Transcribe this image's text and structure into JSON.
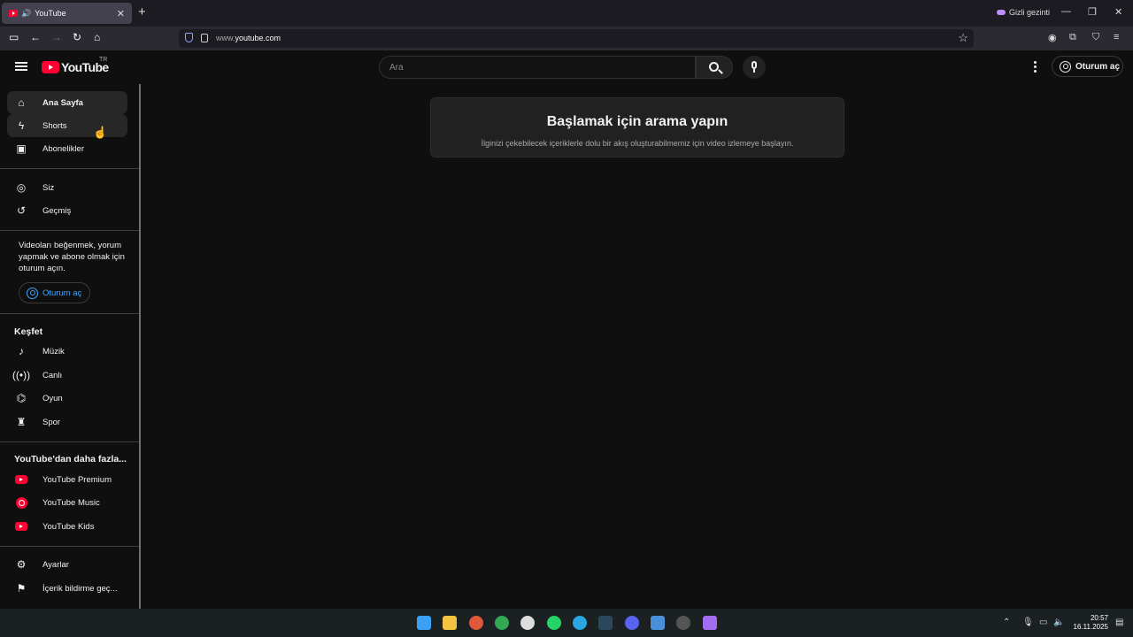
{
  "browser": {
    "tab_title": "YouTube",
    "private_label": "Gizli gezinti",
    "url_prefix": "www.",
    "url_domain": "youtube.com"
  },
  "header": {
    "logo_text": "YouTube",
    "country_code": "TR",
    "search_placeholder": "Ara",
    "signin_label": "Oturum aç"
  },
  "sidebar": {
    "main_items": [
      {
        "label": "Ana Sayfa",
        "icon": "home-icon"
      },
      {
        "label": "Shorts",
        "icon": "shorts-icon"
      },
      {
        "label": "Abonelikler",
        "icon": "subscriptions-icon"
      }
    ],
    "you_items": [
      {
        "label": "Siz",
        "icon": "user-icon"
      },
      {
        "label": "Geçmiş",
        "icon": "history-icon"
      }
    ],
    "promo_text": "Videoları beğenmek, yorum yapmak ve abone olmak için oturum açın.",
    "promo_signin": "Oturum aç",
    "explore_title": "Keşfet",
    "explore_items": [
      {
        "label": "Müzik",
        "icon": "music-icon"
      },
      {
        "label": "Canlı",
        "icon": "live-icon"
      },
      {
        "label": "Oyun",
        "icon": "gaming-icon"
      },
      {
        "label": "Spor",
        "icon": "trophy-icon"
      }
    ],
    "more_title": "YouTube'dan daha fazla...",
    "more_items": [
      {
        "label": "YouTube Premium",
        "icon": "youtube-premium-icon"
      },
      {
        "label": "YouTube Music",
        "icon": "youtube-music-icon"
      },
      {
        "label": "YouTube Kids",
        "icon": "youtube-kids-icon"
      }
    ],
    "settings_items": [
      {
        "label": "Ayarlar",
        "icon": "gear-icon"
      },
      {
        "label": "İçerik bildirme geç...",
        "icon": "flag-icon"
      }
    ]
  },
  "main": {
    "card_title": "Başlamak için arama yapın",
    "card_subtitle": "İlginizi çekebilecek içeriklerle dolu bir akış oluşturabilmemiz için video izlemeye başlayın."
  },
  "taskbar": {
    "time": "20:57",
    "date": "16.11.2025"
  },
  "colors": {
    "accent": "#ff0033",
    "link": "#3ea6ff",
    "bg": "#0f0f0f"
  }
}
